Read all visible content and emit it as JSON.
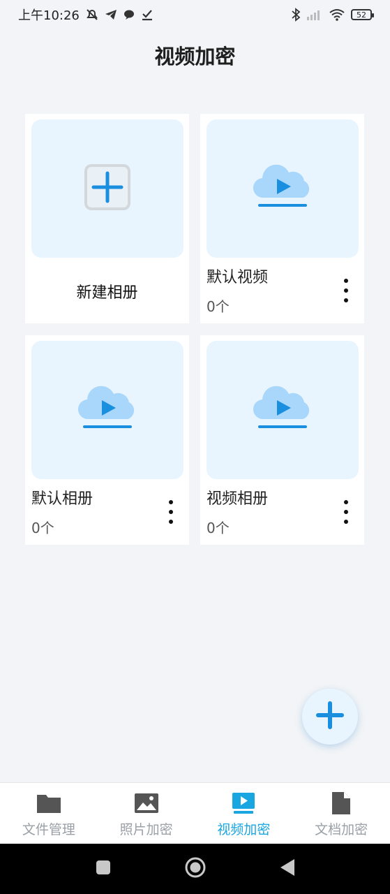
{
  "status_bar": {
    "time": "上午10:26",
    "battery": "52"
  },
  "header": {
    "title": "视频加密"
  },
  "albums": {
    "new_album_label": "新建相册",
    "items": [
      {
        "name": "默认视频",
        "count": "0个"
      },
      {
        "name": "默认相册",
        "count": "0个"
      },
      {
        "name": "视频相册",
        "count": "0个"
      }
    ]
  },
  "bottom_nav": {
    "items": [
      {
        "label": "文件管理",
        "icon": "folder-icon"
      },
      {
        "label": "照片加密",
        "icon": "image-icon"
      },
      {
        "label": "视频加密",
        "icon": "video-icon",
        "active": true
      },
      {
        "label": "文档加密",
        "icon": "document-icon"
      }
    ]
  },
  "colors": {
    "accent": "#1a8fe0",
    "active_tab": "#1aa6e0",
    "thumb_bg": "#e9f5fe",
    "cloud": "#a9d6fb"
  }
}
